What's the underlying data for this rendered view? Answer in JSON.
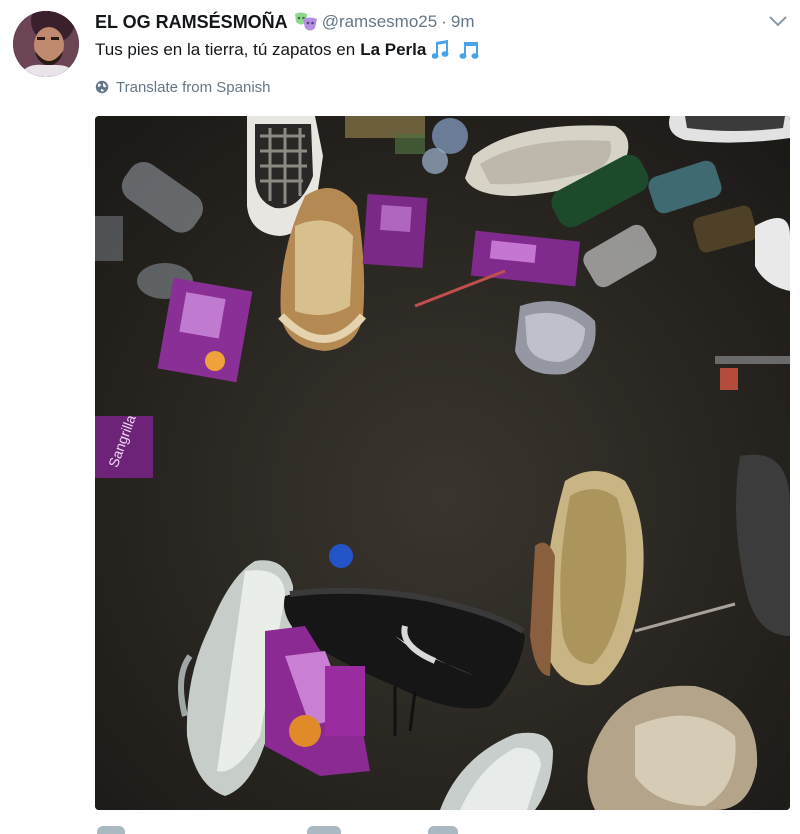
{
  "tweet": {
    "display_name": "EL OG RAMSÉSMOÑA",
    "handle": "@ramsesmo25",
    "separator": "·",
    "time": "9m",
    "text_prefix": "Tus pies en la tierra, tú zapatos en",
    "text_place": "La Perla",
    "translate_label": "Translate from Spanish"
  },
  "icons": {
    "name_emoji": "performing-arts-icon",
    "text_emoji": "musical-notes-icon",
    "translate": "globe-icon",
    "menu": "chevron-down-icon"
  },
  "colors": {
    "primary_text": "#14171a",
    "secondary_text": "#657786",
    "link_blue": "#1da1f2",
    "mask_green": "#8fd88f",
    "mask_purple": "#b68fe0"
  },
  "media": {
    "packet_text": "Sangrilla"
  }
}
